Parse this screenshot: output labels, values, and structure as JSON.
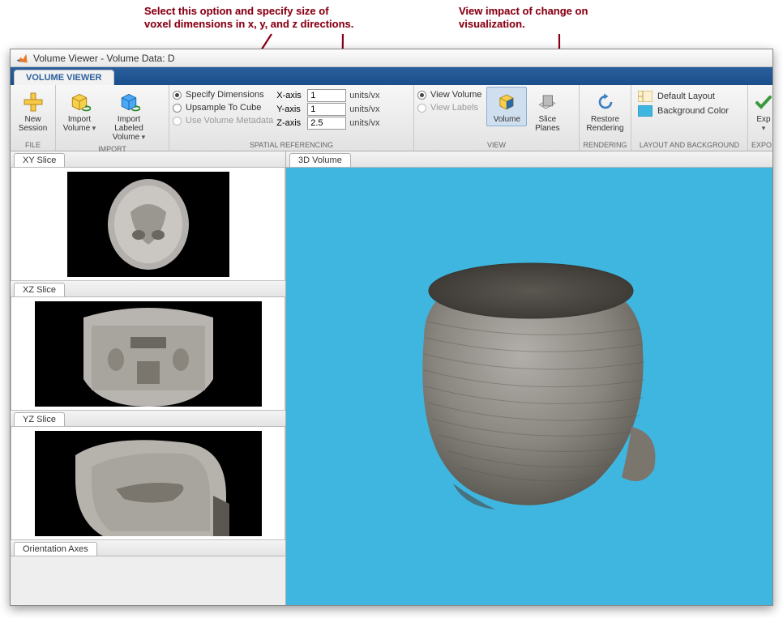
{
  "window": {
    "title": "Volume Viewer - Volume Data: D"
  },
  "annotations": {
    "left_label": "Select this option and specify size of\nvoxel dimensions in x, y, and z directions.",
    "right_label": "View impact of change on\nvisualization."
  },
  "ribbon": {
    "tab_label": "VOLUME VIEWER",
    "file_section": "FILE",
    "import_section": "IMPORT",
    "spatial_section": "SPATIAL REFERENCING",
    "view_section": "VIEW",
    "rendering_section": "RENDERING",
    "layout_section": "LAYOUT AND BACKGROUND",
    "export_section": "EXPO",
    "new_session": "New\nSession",
    "import_volume": "Import\nVolume",
    "import_labeled": "Import Labeled\nVolume",
    "specify_dimensions": "Specify Dimensions",
    "upsample_cube": "Upsample To Cube",
    "use_metadata": "Use Volume Metadata",
    "xaxis_label": "X-axis",
    "yaxis_label": "Y-axis",
    "zaxis_label": "Z-axis",
    "xaxis_value": "1",
    "yaxis_value": "1",
    "zaxis_value": "2.5",
    "units": "units/vx",
    "view_volume": "View Volume",
    "view_labels": "View Labels",
    "volume_btn": "Volume",
    "slice_planes": "Slice\nPlanes",
    "restore_rendering": "Restore\nRendering",
    "default_layout": "Default Layout",
    "background_color": "Background Color",
    "export_btn": "Exp"
  },
  "panels": {
    "xy_slice": "XY Slice",
    "xz_slice": "XZ Slice",
    "yz_slice": "YZ Slice",
    "orientation_axes": "Orientation Axes",
    "volume_3d": "3D Volume"
  },
  "colors": {
    "annotation": "#880015",
    "tabbar": "#205a95",
    "bg3d": "#3fb6df"
  }
}
